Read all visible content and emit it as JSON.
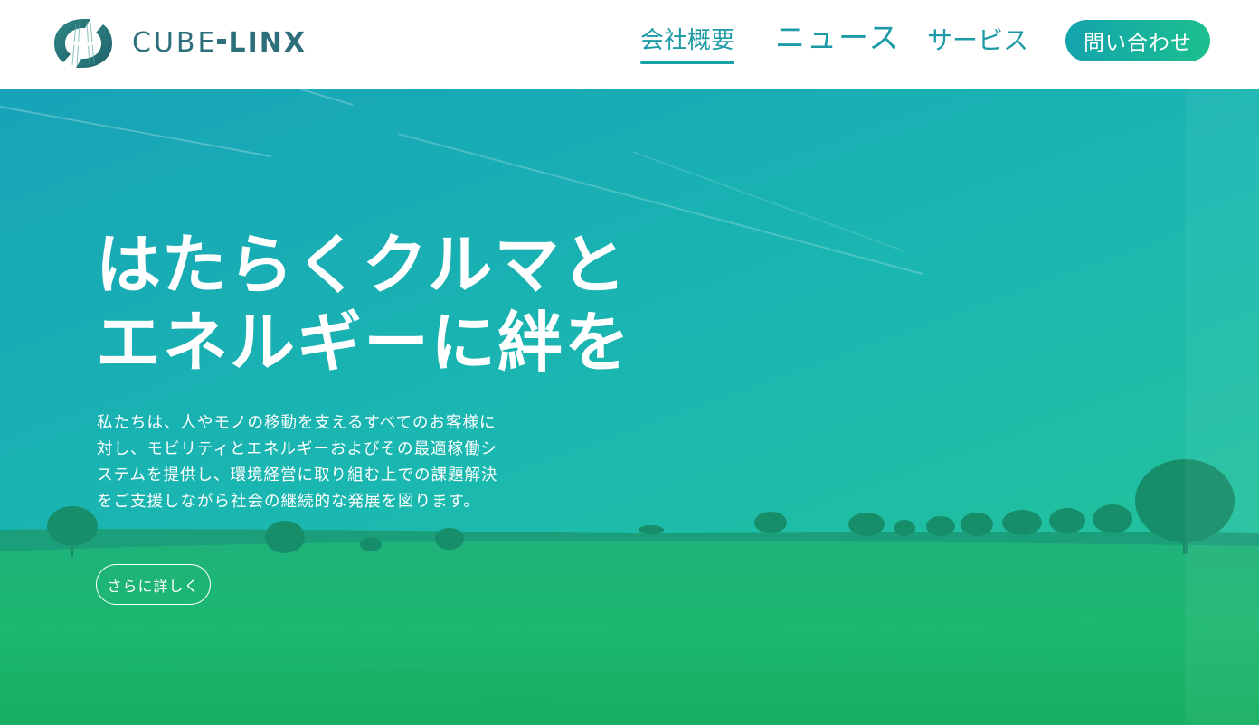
{
  "header": {
    "logo": {
      "icon": "cubelinx-logo-mark",
      "text_part1": "CUBE",
      "text_part2": "LINX"
    },
    "nav": {
      "company": "会社概要",
      "news": "ニュース",
      "services": "サービス",
      "contact": "問い合わせ"
    },
    "active_nav": "company"
  },
  "hero": {
    "title_line1": "はたらくクルマと",
    "title_line2": "エネルギーに絆を",
    "description": "私たちは、人やモノの移動を支えるすべてのお客様に対し、モビリティとエネルギーおよびその最適稼働システムを提供し、環境経営に取り組む上での課題解決をご支援しながら社会の継続的な発展を図ります。",
    "more_button": "さらに詳しく"
  },
  "colors": {
    "brand_teal": "#1c9aa6",
    "logo_text": "#2d6f7a",
    "gradient_start": "#14a3ad",
    "gradient_end": "#1bc08e"
  }
}
